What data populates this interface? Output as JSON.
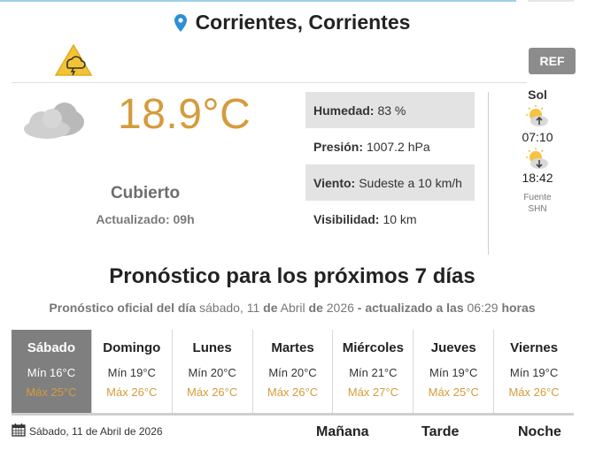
{
  "location": {
    "name": "Corrientes, Corrientes"
  },
  "alert": {
    "icon": "storm-warning-icon"
  },
  "ref_button": {
    "label": "REF"
  },
  "current": {
    "icon": "cloud-icon",
    "temperature": "18.9°C",
    "condition": "Cubierto",
    "updated_label": "Actualizado: 09h"
  },
  "details": [
    {
      "label": "Humedad:",
      "value": "83 %"
    },
    {
      "label": "Presión:",
      "value": "1007.2 hPa"
    },
    {
      "label": "Viento:",
      "value": "Sudeste a 10 km/h"
    },
    {
      "label": "Visibilidad:",
      "value": "10 km"
    }
  ],
  "sun": {
    "title": "Sol",
    "sunrise": "07:10",
    "sunset": "18:42",
    "source_label": "Fuente",
    "source_name": "SHN"
  },
  "forecast": {
    "title": "Pronóstico para los próximos 7 días",
    "sub_prefix": "Pronóstico oficial del día",
    "sub_weekday": "sábado, 11",
    "sub_de1": "de",
    "sub_month": "Abril",
    "sub_de2": "de",
    "sub_year": "2026",
    "sub_updated": "- actualizado a las",
    "sub_time": "06:29",
    "sub_hours": "horas",
    "days": [
      {
        "name": "Sábado",
        "min": "Mín 16°C",
        "max": "Máx 25°C"
      },
      {
        "name": "Domingo",
        "min": "Mín 19°C",
        "max": "Máx 26°C"
      },
      {
        "name": "Lunes",
        "min": "Mín 20°C",
        "max": "Máx 26°C"
      },
      {
        "name": "Martes",
        "min": "Mín 20°C",
        "max": "Máx 26°C"
      },
      {
        "name": "Miércoles",
        "min": "Mín 21°C",
        "max": "Máx 27°C"
      },
      {
        "name": "Jueves",
        "min": "Mín 19°C",
        "max": "Máx 25°C"
      },
      {
        "name": "Viernes",
        "min": "Mín 19°C",
        "max": "Máx 26°C"
      }
    ],
    "selected_index": 0
  },
  "detail_bar": {
    "date": "Sábado, 11 de Abril de 2026",
    "periods": [
      "Mañana",
      "Tarde",
      "Noche"
    ]
  },
  "colors": {
    "accent_temp": "#d59b3d",
    "pin": "#2d8fd5",
    "alert": "#f2c335",
    "active_day_bg": "#7f7f7f"
  }
}
